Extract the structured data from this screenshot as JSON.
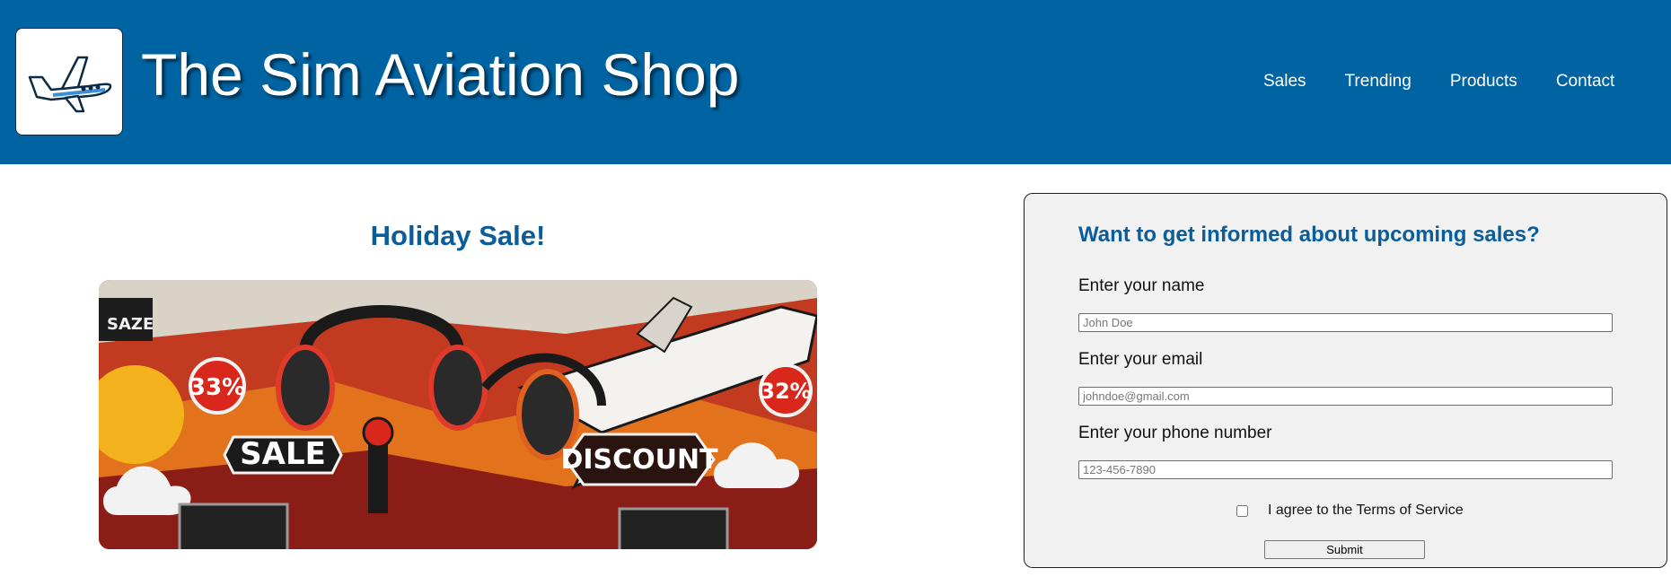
{
  "header": {
    "logo_icon": "airplane-icon",
    "title": "The Sim Aviation Shop",
    "nav": [
      "Sales",
      "Trending",
      "Products",
      "Contact"
    ],
    "brand_color": "#0063a2"
  },
  "promo": {
    "title": "Holiday Sale!",
    "banner": {
      "badge_left": "33%",
      "badge_right": "32%",
      "tag_corner": "SAZE",
      "sign_left": "SALE",
      "sign_right": "DISCOUNT"
    }
  },
  "signup": {
    "title": "Want to get informed about upcoming sales?",
    "name_label": "Enter your name",
    "name_placeholder": "John Doe",
    "email_label": "Enter your email",
    "email_placeholder": "johndoe@gmail.com",
    "phone_label": "Enter your phone number",
    "phone_placeholder": "123-456-7890",
    "terms_label": "I agree to the Terms of Service",
    "submit_label": "Submit",
    "accent_color": "#0b5d9a"
  }
}
